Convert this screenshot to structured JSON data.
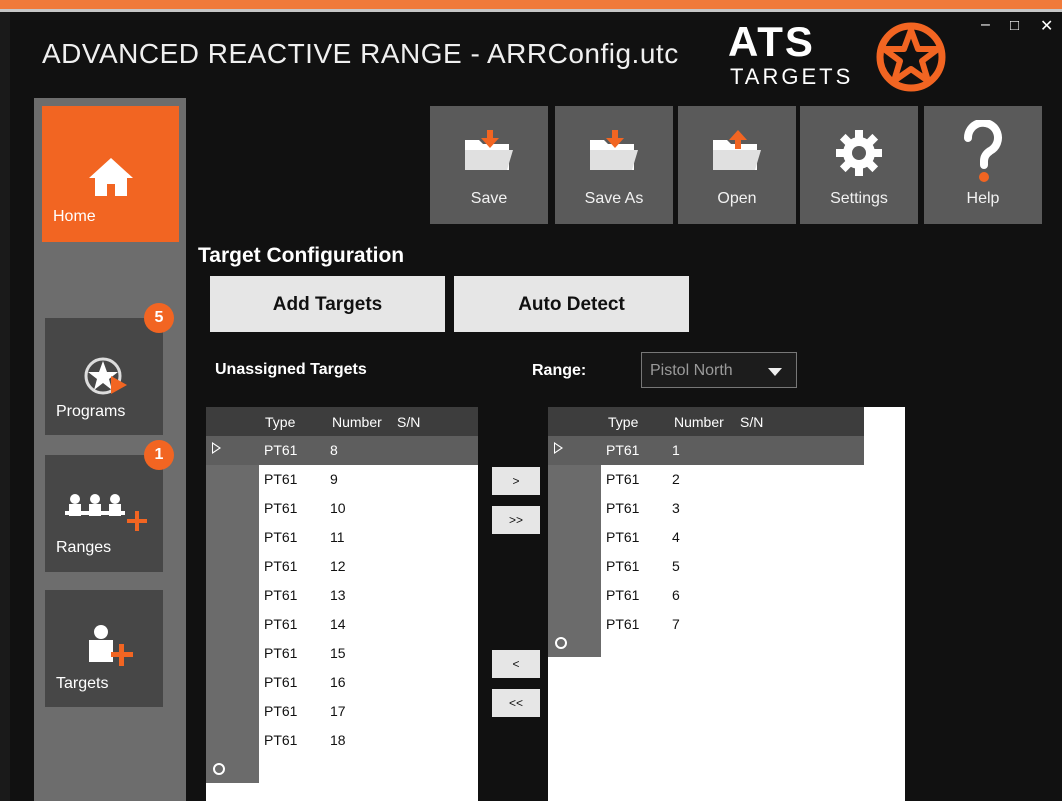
{
  "window": {
    "title": "ADVANCED REACTIVE RANGE - ARRConfig.utc",
    "minimize": "–",
    "maximize": "□",
    "close": "✕"
  },
  "logo": {
    "ats": "ATS",
    "targets": "TARGETS"
  },
  "sidebar": {
    "items": [
      {
        "label": "Home",
        "icon": "home-icon"
      },
      {
        "label": "Programs",
        "icon": "star-play-icon",
        "badge": "5"
      },
      {
        "label": "Ranges",
        "icon": "targets-add-icon",
        "badge": "1"
      },
      {
        "label": "Targets",
        "icon": "target-add-icon"
      }
    ]
  },
  "toolbar": {
    "buttons": [
      {
        "label": "Save",
        "icon": "save-folder-icon"
      },
      {
        "label": "Save As",
        "icon": "save-as-folder-icon"
      },
      {
        "label": "Open",
        "icon": "open-folder-icon"
      },
      {
        "label": "Settings",
        "icon": "gear-icon"
      },
      {
        "label": "Help",
        "icon": "help-icon"
      }
    ]
  },
  "main": {
    "section_title": "Target Configuration",
    "add_targets": "Add Targets",
    "auto_detect": "Auto Detect",
    "unassigned_label": "Unassigned Targets",
    "range_label": "Range:",
    "range_value": "Pistol North",
    "move_right": ">",
    "move_all_right": ">>",
    "move_left": "<",
    "move_all_left": "<<"
  },
  "unassigned": {
    "columns": [
      "Type",
      "Number",
      "S/N"
    ],
    "rows": [
      {
        "type": "PT61",
        "number": "8",
        "sn": ""
      },
      {
        "type": "PT61",
        "number": "9",
        "sn": ""
      },
      {
        "type": "PT61",
        "number": "10",
        "sn": ""
      },
      {
        "type": "PT61",
        "number": "11",
        "sn": ""
      },
      {
        "type": "PT61",
        "number": "12",
        "sn": ""
      },
      {
        "type": "PT61",
        "number": "13",
        "sn": ""
      },
      {
        "type": "PT61",
        "number": "14",
        "sn": ""
      },
      {
        "type": "PT61",
        "number": "15",
        "sn": ""
      },
      {
        "type": "PT61",
        "number": "16",
        "sn": ""
      },
      {
        "type": "PT61",
        "number": "17",
        "sn": ""
      },
      {
        "type": "PT61",
        "number": "18",
        "sn": ""
      }
    ]
  },
  "assigned": {
    "columns": [
      "Type",
      "Number",
      "S/N"
    ],
    "rows": [
      {
        "type": "PT61",
        "number": "1",
        "sn": ""
      },
      {
        "type": "PT61",
        "number": "2",
        "sn": ""
      },
      {
        "type": "PT61",
        "number": "3",
        "sn": ""
      },
      {
        "type": "PT61",
        "number": "4",
        "sn": ""
      },
      {
        "type": "PT61",
        "number": "5",
        "sn": ""
      },
      {
        "type": "PT61",
        "number": "6",
        "sn": ""
      },
      {
        "type": "PT61",
        "number": "7",
        "sn": ""
      }
    ]
  },
  "colors": {
    "accent": "#f26522",
    "sidebar": "#6d6d6d",
    "tile": "#474747",
    "toolbar": "#5a5a5a"
  }
}
